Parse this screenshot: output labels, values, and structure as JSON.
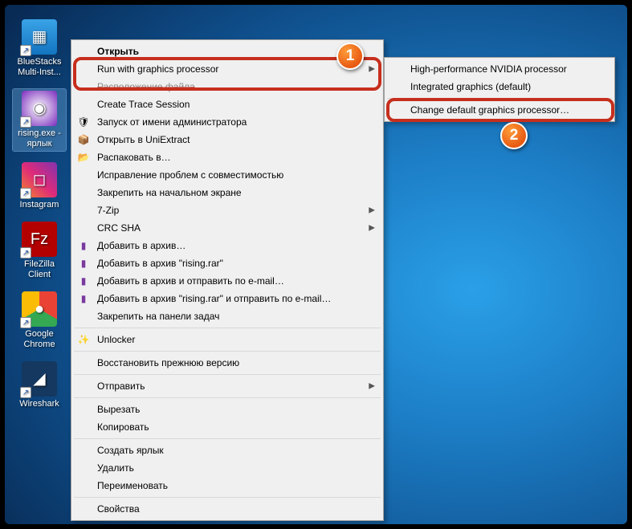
{
  "desktop_icons": [
    {
      "label": "BlueStacks Multi-Inst...",
      "bg": "linear-gradient(#3aa3e6,#1374c0)",
      "glyph": "▦"
    },
    {
      "label": "rising.exe - ярлык",
      "bg": "radial-gradient(circle,#fff,#7a2bbd)",
      "glyph": "◉",
      "selected": true
    },
    {
      "label": "Instagram",
      "bg": "linear-gradient(45deg,#f58529,#dd2a7b,#8134af)",
      "glyph": "◻"
    },
    {
      "label": "FileZilla Client",
      "bg": "#b30000",
      "glyph": "Fz"
    },
    {
      "label": "Google Chrome",
      "bg": "conic-gradient(#ea4335 0 120deg,#34a853 120deg 240deg,#fbbc05 240deg 360deg)",
      "glyph": "●"
    },
    {
      "label": "Wireshark",
      "bg": "#14385f",
      "glyph": "◢"
    }
  ],
  "menu": {
    "open": "Открыть",
    "run_gpu": "Run with graphics processor",
    "file_loc": "Расположение файла",
    "create_trace": "Create Trace Session",
    "run_admin": "Запуск от имени администратора",
    "uniextract": "Открыть в UniExtract",
    "unpack": "Распаковать в…",
    "compat": "Исправление проблем с совместимостью",
    "pin_start": "Закрепить на начальном экране",
    "zip": "7-Zip",
    "crc": "CRC SHA",
    "add_archive": "Добавить в архив…",
    "add_rar": "Добавить в архив \"rising.rar\"",
    "archive_email": "Добавить в архив и отправить по e-mail…",
    "rar_email": "Добавить в архив \"rising.rar\" и отправить по e-mail…",
    "pin_taskbar": "Закрепить на панели задач",
    "unlocker": "Unlocker",
    "restore": "Восстановить прежнюю версию",
    "send": "Отправить",
    "cut": "Вырезать",
    "copy": "Копировать",
    "create_shortcut": "Создать ярлык",
    "delete": "Удалить",
    "rename": "Переименовать",
    "properties": "Свойства"
  },
  "submenu": {
    "hp": "High-performance NVIDIA processor",
    "ig": "Integrated graphics (default)",
    "change": "Change default graphics processor…"
  },
  "badges": {
    "one": "1",
    "two": "2"
  }
}
